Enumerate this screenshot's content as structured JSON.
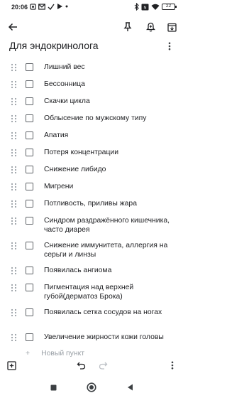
{
  "status_bar": {
    "time": "20:06",
    "left_icons": [
      "notification-icon",
      "mail-icon",
      "check-icon",
      "play-icon",
      "dot-icon"
    ],
    "right_icons": [
      "bluetooth-icon",
      "sim-icon",
      "wifi-icon",
      "battery-icon"
    ],
    "battery": "22"
  },
  "toolbar": {
    "back_icon": "arrow-left-icon",
    "pin_icon": "pin-icon",
    "reminder_icon": "bell-plus-icon",
    "archive_icon": "archive-icon"
  },
  "note": {
    "title": "Для эндокринолога",
    "items": [
      {
        "text": "Лишний вес",
        "checked": false
      },
      {
        "text": "Бессонница",
        "checked": false
      },
      {
        "text": "Скачки цикла",
        "checked": false
      },
      {
        "text": "Облысение по мужскому типу",
        "checked": false
      },
      {
        "text": "Апатия",
        "checked": false
      },
      {
        "text": "Потеря концентрации",
        "checked": false
      },
      {
        "text": "Снижение либидо",
        "checked": false
      },
      {
        "text": "Мигрени",
        "checked": false
      },
      {
        "text": "Потливость, приливы жара",
        "checked": false
      },
      {
        "text": "Синдром раздражённого кишечника, часто диарея",
        "checked": false
      },
      {
        "text": "Снижение иммунитета, аллергия на серьги и линзы",
        "checked": false
      },
      {
        "text": "Появилась ангиома",
        "checked": false
      },
      {
        "text": "Пигментация над верхней губой(дерматоз Брока)",
        "checked": false
      },
      {
        "text": "Появилась сетка сосудов на ногах",
        "checked": false
      },
      {
        "text": "Увеличение жирности кожи головы",
        "checked": false
      }
    ],
    "new_item_placeholder": "Новый пункт"
  },
  "bottom_bar": {
    "icons": [
      "add-box-icon",
      "undo-icon",
      "redo-icon",
      "more-vert-icon"
    ]
  },
  "nav_bar": {
    "icons": [
      "recents-square-icon",
      "home-circle-icon",
      "back-triangle-icon"
    ]
  }
}
